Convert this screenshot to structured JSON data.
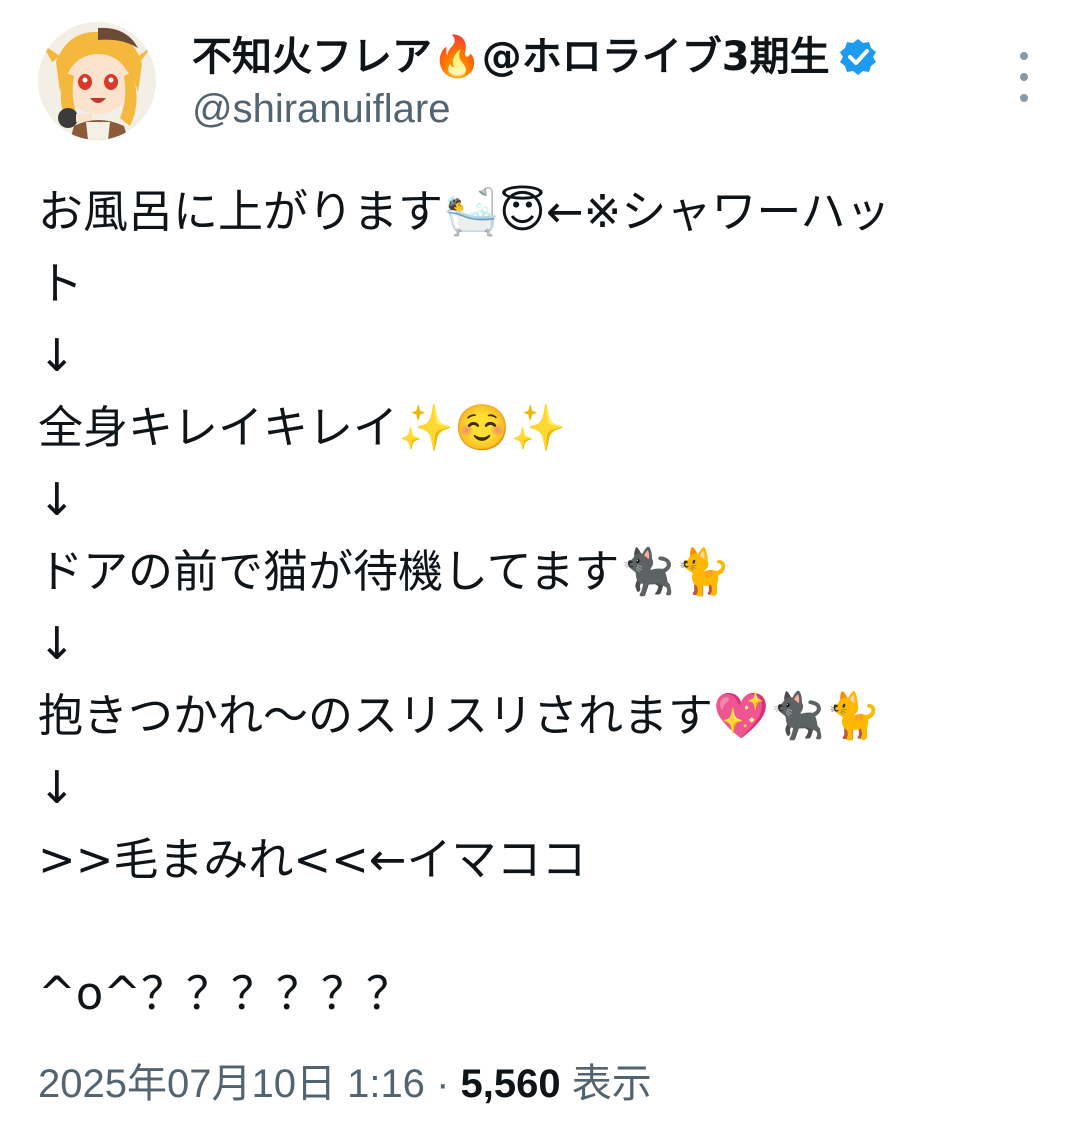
{
  "user": {
    "display_name": "不知火フレア🔥@ホロライブ3期生",
    "handle": "@shiranuiflare",
    "verified": true,
    "verified_color": "#1d9bf0",
    "avatar_icon": "avatar-elf-girl"
  },
  "more_icon": "more-vertical-icon",
  "tweet": {
    "lines": [
      "お風呂に上がります🛀😇←※シャワーハッ",
      "ト",
      "↓",
      "全身キレイキレイ✨☺️✨",
      "↓",
      "ドアの前で猫が待機してます🐈‍⬛🐈",
      "↓",
      "抱きつかれ〜のスリスリされます💖🐈‍⬛🐈",
      "↓",
      ">>毛まみれ<<←イマココ",
      "",
      "^o^？？？？？？"
    ]
  },
  "meta": {
    "timestamp": "2025年07月10日 1:16",
    "separator": "·",
    "view_count": "5,560",
    "view_label": "表示"
  }
}
